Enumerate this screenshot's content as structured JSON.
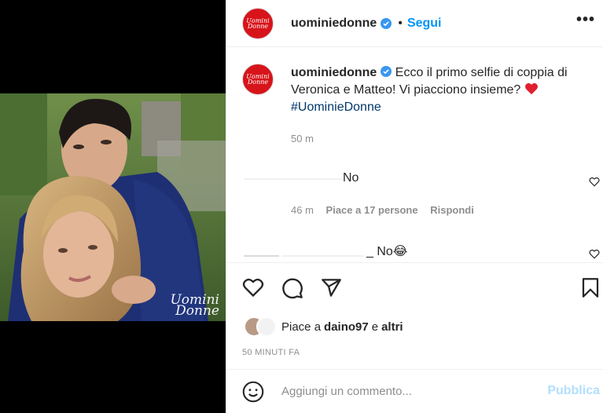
{
  "post": {
    "username": "uominiedonne",
    "follow_label": "Segui",
    "dot": "•",
    "more": "•••",
    "avatar_text_1": "Uomini",
    "avatar_text_2": "Donne",
    "watermark_1": "Uomini",
    "watermark_2": "Donne"
  },
  "caption": {
    "username": "uominiedonne",
    "text": "Ecco il primo selfie di coppia di Veronica e Matteo! Vi piacciono insieme?",
    "hashtag": "#UominieDonne",
    "time": "50 m"
  },
  "comments": [
    {
      "text": "No",
      "time": "46 m",
      "likes": "Piace a 17 persone",
      "reply": "Rispondi"
    },
    {
      "text": "_ No😂"
    }
  ],
  "likes": {
    "prefix": "Piace a",
    "user": "daino97",
    "conj": "e",
    "others": "altri"
  },
  "post_time": "50 MINUTI FA",
  "add_comment": {
    "placeholder": "Aggiungi un commento...",
    "publish": "Pubblica"
  },
  "colors": {
    "brand": "#d7141a",
    "link": "#0095f6",
    "publish_disabled": "#b2dffc"
  }
}
